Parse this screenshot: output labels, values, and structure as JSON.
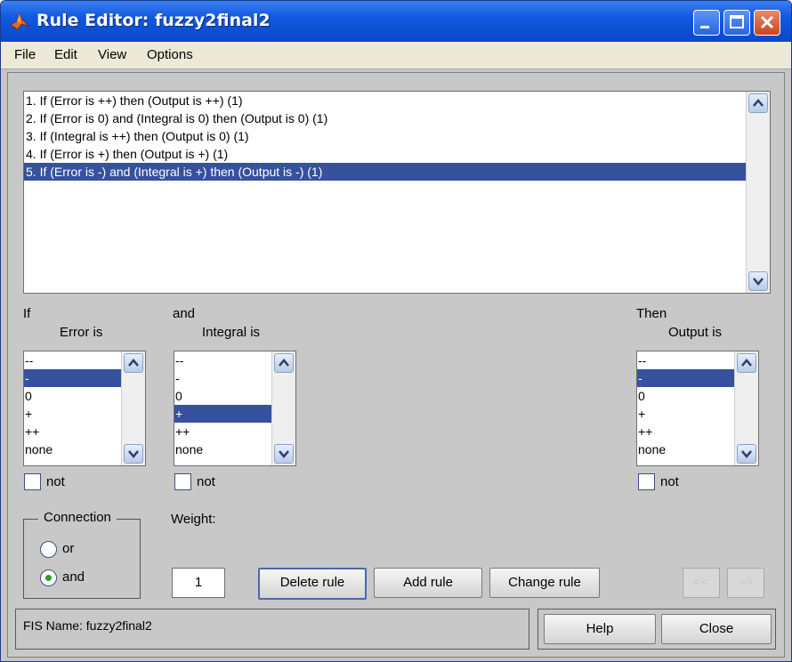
{
  "window": {
    "title": "Rule Editor: fuzzy2final2"
  },
  "menu": {
    "items": [
      "File",
      "Edit",
      "View",
      "Options"
    ]
  },
  "rules": {
    "items": [
      "1. If (Error is ++) then (Output is ++) (1)",
      "2. If (Error is 0) and (Integral is 0) then (Output is 0) (1)",
      "3. If (Integral is ++) then (Output is 0) (1)",
      "4. If (Error is +) then (Output is +) (1)",
      "5. If (Error is -) and (Integral is +) then (Output is -) (1)"
    ],
    "selected_index": 4
  },
  "inputs": {
    "if_label": "If",
    "error_label": "Error is",
    "and_label": "and",
    "integral_label": "Integral is",
    "then_label": "Then",
    "output_label": "Output is",
    "options": [
      "--",
      "-",
      "0",
      "+",
      "++",
      "none"
    ],
    "error_selected": "-",
    "integral_selected": "+",
    "output_selected": "-",
    "not_label": "not"
  },
  "connection": {
    "title": "Connection",
    "or_label": "or",
    "and_label": "and",
    "selected": "and"
  },
  "weight": {
    "label": "Weight:",
    "value": "1"
  },
  "buttons": {
    "delete_rule": "Delete rule",
    "add_rule": "Add rule",
    "change_rule": "Change rule",
    "prev": "<<",
    "next": ">>",
    "help": "Help",
    "close": "Close"
  },
  "status": {
    "fis_name": "FIS Name: fuzzy2final2"
  },
  "colors": {
    "titlebar": "#0a49c8",
    "selection": "#36519e",
    "panel": "#c8c8c8"
  }
}
